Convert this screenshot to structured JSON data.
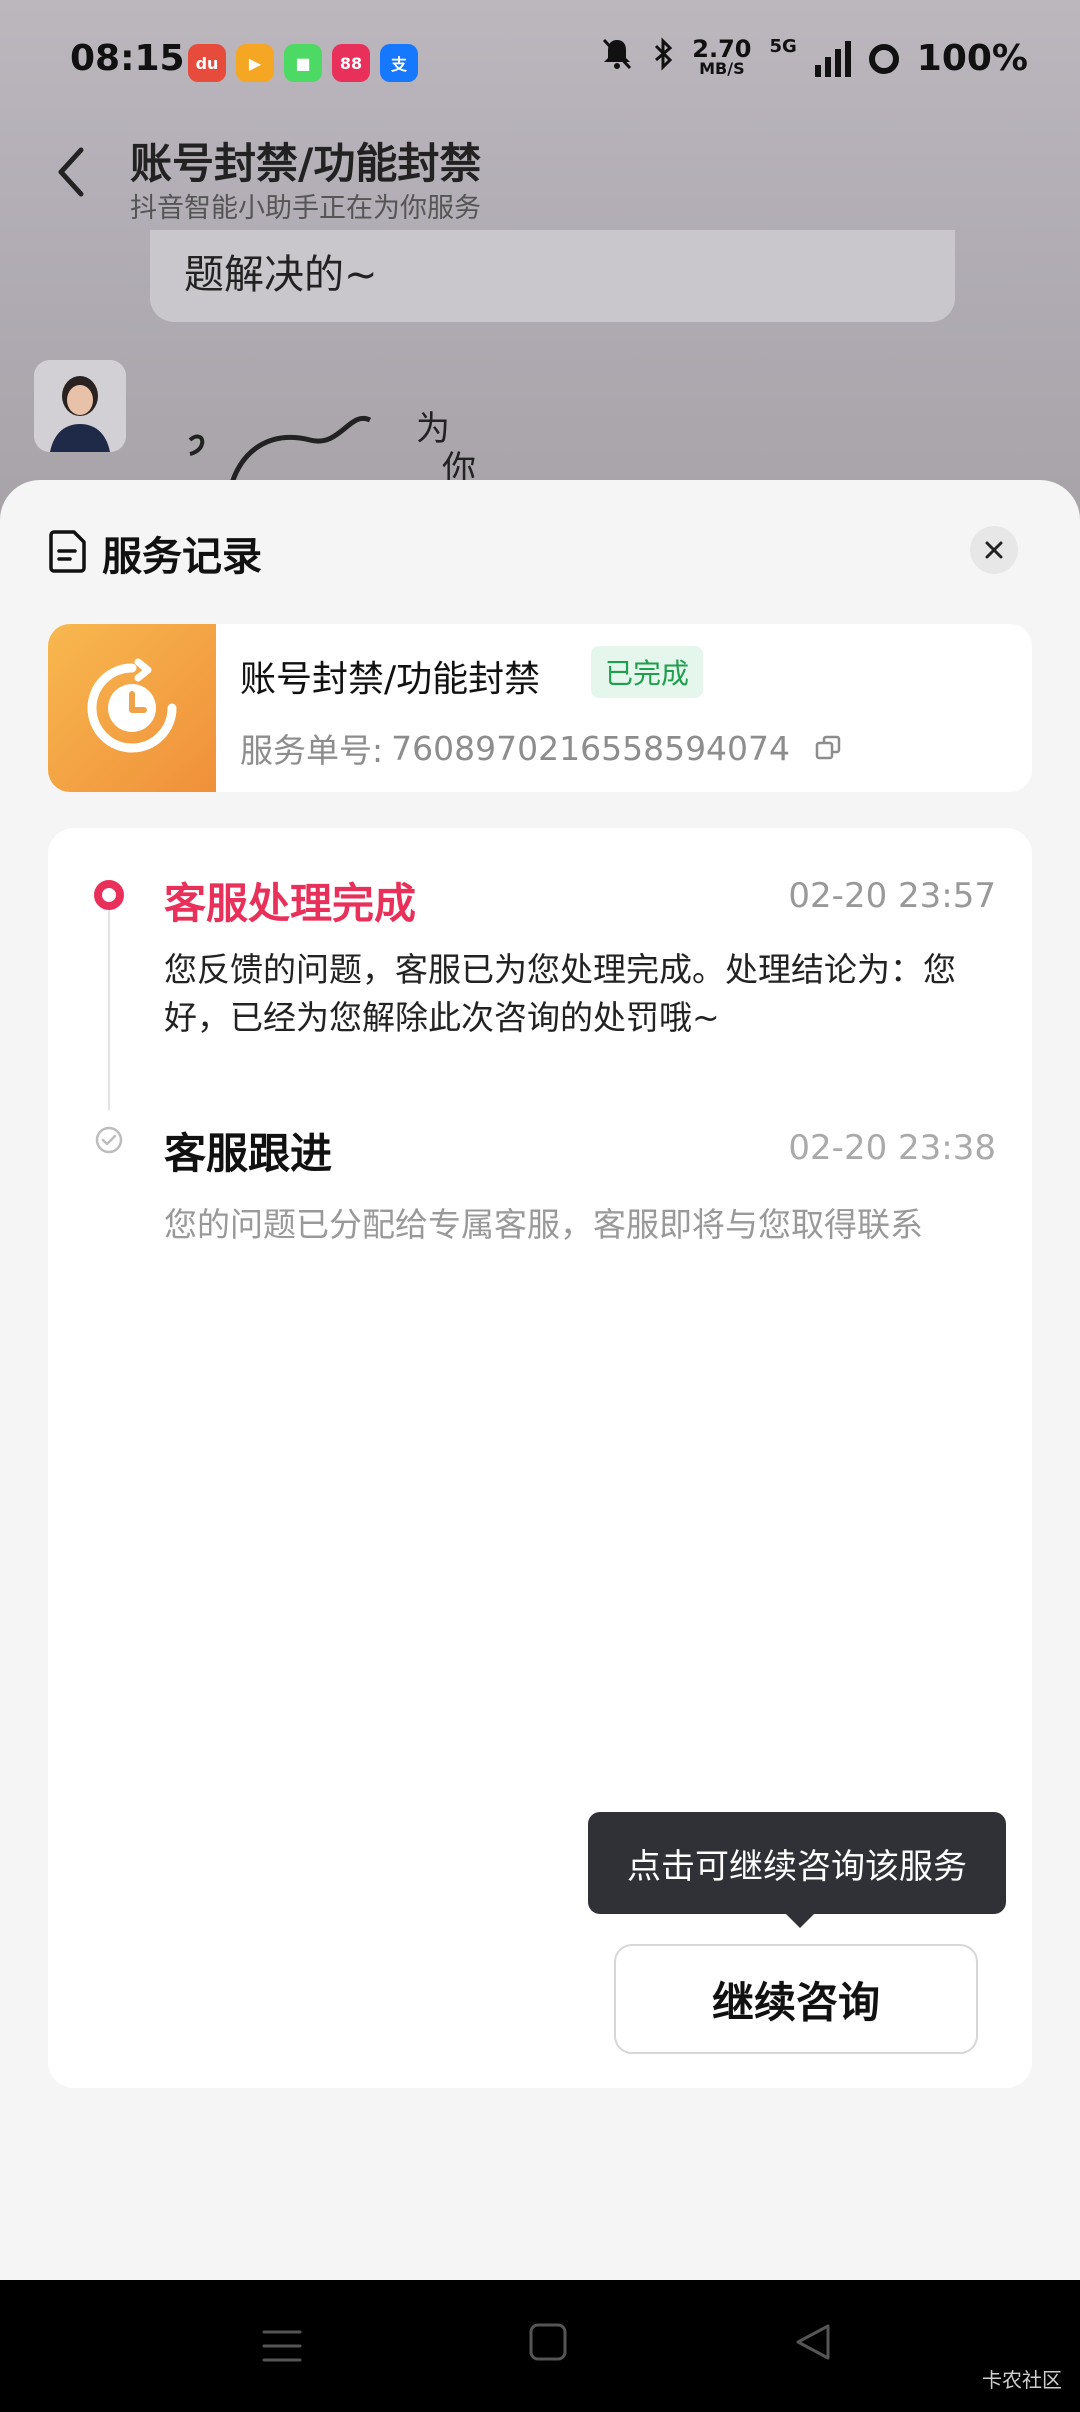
{
  "status_bar": {
    "time": "08:15",
    "net_speed_value": "2.70",
    "net_speed_unit": "MB/S",
    "network_type": "5G",
    "battery": "100%",
    "apps": [
      {
        "icon": "map-app-icon",
        "color": "#e64b3c",
        "glyph": "du"
      },
      {
        "icon": "video-app-icon",
        "color": "#f5a623",
        "glyph": "▶"
      },
      {
        "icon": "message-app-icon",
        "color": "#4cd964",
        "glyph": "■"
      },
      {
        "icon": "shopping-app-icon",
        "color": "#e8305a",
        "glyph": "88"
      },
      {
        "icon": "alipay-app-icon",
        "color": "#1677ff",
        "glyph": "支"
      }
    ]
  },
  "chat": {
    "title": "账号封禁/功能封禁",
    "subtitle": "抖音智能小助手正在为你服务",
    "bubble_text": "题解决的~"
  },
  "sheet": {
    "title": "服务记录",
    "service": {
      "name": "账号封禁/功能封禁",
      "status": "已完成",
      "order_label": "服务单号:",
      "order_number": "7608970216558594074"
    },
    "timeline": [
      {
        "title": "客服处理完成",
        "time": "02-20 23:57",
        "desc": "您反馈的问题，客服已为您处理完成。处理结论为：您好，已经为您解除此次咨询的处罚哦~"
      },
      {
        "title": "客服跟进",
        "time": "02-20 23:38",
        "desc": "您的问题已分配给专属客服，客服即将与您取得联系"
      }
    ],
    "tooltip": "点击可继续咨询该服务",
    "continue_button": "继续咨询"
  },
  "watermark": "卡农社区",
  "colors": {
    "accent": "#e8305a",
    "success": "#1f9e4d",
    "tooltip_bg": "#2f3137"
  }
}
